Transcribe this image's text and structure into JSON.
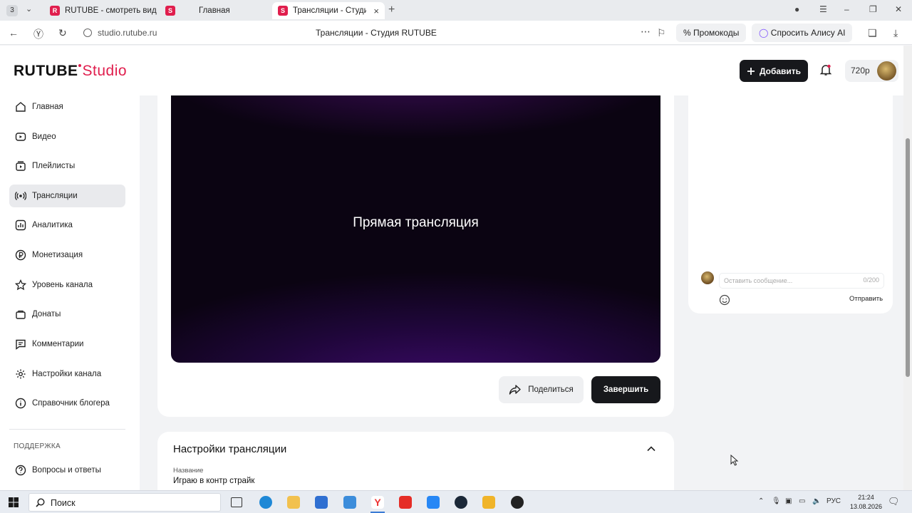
{
  "browser": {
    "tab_count": "3",
    "tabs": [
      {
        "title": "RUTUBE - смотреть видео"
      },
      {
        "title": "Главная"
      },
      {
        "title": "Трансляции - Студия RUTUBE"
      }
    ],
    "url": "studio.rutube.ru",
    "page_title": "Трансляции - Студия RUTUBE",
    "promo_label": "Промокоды",
    "alisa_label": "Спросить Алису AI"
  },
  "header": {
    "logo_text": "RUTUBE",
    "logo_suffix": "Studio",
    "add_label": "Добавить",
    "quality": "720p"
  },
  "sidebar": {
    "items": [
      {
        "label": "Главная",
        "icon": "home-icon"
      },
      {
        "label": "Видео",
        "icon": "video-icon"
      },
      {
        "label": "Плейлисты",
        "icon": "playlist-icon"
      },
      {
        "label": "Трансляции",
        "icon": "broadcast-icon"
      },
      {
        "label": "Аналитика",
        "icon": "analytics-icon"
      },
      {
        "label": "Монетизация",
        "icon": "ruble-icon"
      },
      {
        "label": "Уровень канала",
        "icon": "star-icon"
      },
      {
        "label": "Донаты",
        "icon": "donate-icon"
      },
      {
        "label": "Комментарии",
        "icon": "comment-icon"
      },
      {
        "label": "Настройки канала",
        "icon": "gear-icon"
      },
      {
        "label": "Справочник блогера",
        "icon": "info-icon"
      }
    ],
    "support_caption": "ПОДДЕРЖКА",
    "faq_label": "Вопросы и ответы"
  },
  "player": {
    "overlay_text": "Прямая трансляция",
    "share_label": "Поделиться",
    "end_label": "Завершить"
  },
  "chat": {
    "placeholder": "Оставить сообщение...",
    "counter": "0/200",
    "send_label": "Отправить"
  },
  "settings": {
    "title": "Настройки трансляции",
    "name_label": "Название",
    "name_value": "Играю в контр страйк"
  },
  "taskbar": {
    "search_placeholder": "Поиск",
    "lang": "РУС",
    "time": "21:24",
    "date": "13.08.2026"
  },
  "colors": {
    "accent": "#e01e4d",
    "dark_button": "#17181c",
    "active_item": "#e9eaed"
  }
}
